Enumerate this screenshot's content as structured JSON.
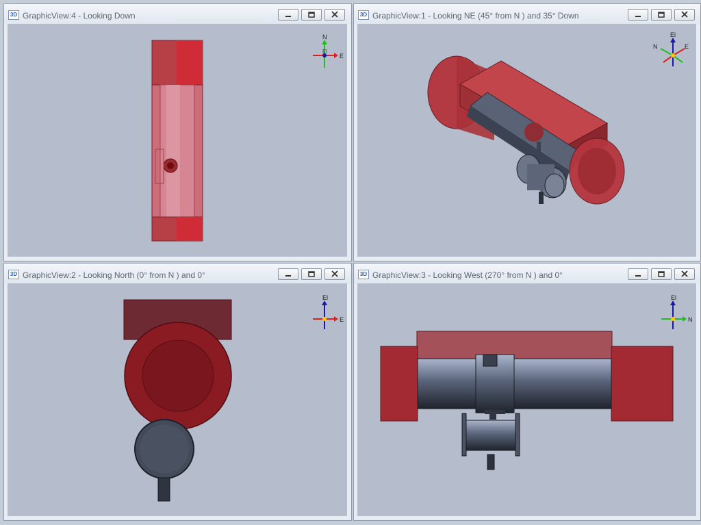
{
  "views": [
    {
      "badge": "3D",
      "title": "GraphicView:4 - Looking Down",
      "triad": {
        "up": "N",
        "right": "E",
        "center": "El"
      }
    },
    {
      "badge": "3D",
      "title": "GraphicView:1 - Looking NE (45° from N ) and 35° Down",
      "triad": {
        "up": "El",
        "left": "N",
        "right": "E"
      }
    },
    {
      "badge": "3D",
      "title": "GraphicView:2 - Looking North (0° from N ) and 0°",
      "triad": {
        "up": "El",
        "right": "E"
      }
    },
    {
      "badge": "3D",
      "title": "GraphicView:3 - Looking West (270° from N ) and 0°",
      "triad": {
        "up": "El",
        "right": "N"
      }
    }
  ],
  "colors": {
    "canvas_background": "#b5bccb",
    "component_red": "#c8333c",
    "pipe_steel": "#4a5264",
    "axis_red": "#e02020",
    "axis_green": "#1fbf1f",
    "axis_blue": "#1a1aa8"
  }
}
